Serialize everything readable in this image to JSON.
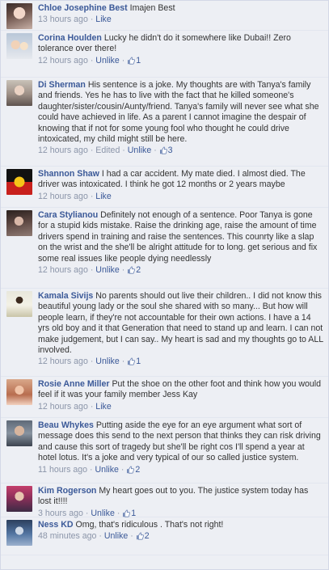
{
  "colors": {
    "link": "#3b5998",
    "meta": "#8b95a9",
    "background": "#edeff4"
  },
  "labels": {
    "like": "Like",
    "unlike": "Unlike",
    "edited": "Edited",
    "sep": "·"
  },
  "icons": {
    "like": "thumbs-up-icon"
  },
  "comments": [
    {
      "id": "c0",
      "name": "Chloe Josephine Best",
      "text": "Imajen Best",
      "time": "13 hours ago",
      "action": "Like",
      "edited": false,
      "likes": null,
      "avatar": "profile-photo"
    },
    {
      "id": "c1",
      "name": "Corina Houlden",
      "text": "Lucky he didn't do it somewhere like Dubai!! Zero tolerance over there!",
      "time": "12 hours ago",
      "action": "Unlike",
      "edited": false,
      "likes": "1",
      "avatar": "profile-photo"
    },
    {
      "id": "c2",
      "name": "Di Sherman",
      "text": "His sentence is a joke. My thoughts are with Tanya's family and friends. Yes he has to live with the fact that he killed someone's daughter/sister/cousin/Aunty/friend. Tanya's family will never see what she could have achieved in life. As a parent I cannot imagine the despair of knowing that if not for some young fool who thought he could drive intoxicated, my child might still be here.",
      "time": "12 hours ago",
      "action": "Unlike",
      "edited": true,
      "likes": "3",
      "avatar": "profile-photo"
    },
    {
      "id": "c3",
      "name": "Shannon Shaw",
      "text": "I had a car accident. My mate died. I almost died. The driver was intoxicated. I think he got 12 months or 2 years maybe",
      "time": "12 hours ago",
      "action": "Like",
      "edited": false,
      "likes": null,
      "avatar": "aboriginal-flag"
    },
    {
      "id": "c4",
      "name": "Cara Stylianou",
      "text": "Definitely not enough of a sentence. Poor Tanya is gone for a stupid kids mistake. Raise the drinking age, raise the amount of time drivers spend in training and raise the sentences. This counrty like a slap on the wrist and the she'll be alright attitude for to long. get serious and fix some real issues like people dying needlessly",
      "time": "12 hours ago",
      "action": "Unlike",
      "edited": false,
      "likes": "2",
      "avatar": "profile-photo"
    },
    {
      "id": "c5",
      "name": "Kamala Sivijs",
      "text": "No parents should out live their children.. I did not know this beautiful young lady or the soul she shared with so many... But how will people learn, if they're not accountable for their own actions. I have a 14 yrs old boy and it that Generation that need to stand up and learn. I can not make judgement, but I can say.. My heart is sad and my thoughts go to ALL involved.",
      "time": "12 hours ago",
      "action": "Unlike",
      "edited": false,
      "likes": "1",
      "avatar": "profile-photo"
    },
    {
      "id": "c6",
      "name": "Rosie Anne Miller",
      "text": "Put the shoe on the other foot and think how you would feel if it was your family member Jess Kay",
      "time": "12 hours ago",
      "action": "Like",
      "edited": false,
      "likes": null,
      "avatar": "profile-photo"
    },
    {
      "id": "c7",
      "name": "Beau Whykes",
      "text": "Putting aside the eye for an eye argument what sort of message does this send to the next person that thinks they can risk driving and cause this sort of tragedy but she'll be right cos I'll spend a year at hotel lotus. It's a joke and very typical of our so called justice system.",
      "time": "11 hours ago",
      "action": "Unlike",
      "edited": false,
      "likes": "2",
      "avatar": "profile-photo"
    },
    {
      "id": "c8",
      "name": "Kim Rogerson",
      "text": "My heart goes out to you. The justice system today has lost it!!!!",
      "time": "3 hours ago",
      "action": "Unlike",
      "edited": false,
      "likes": "1",
      "avatar": "profile-photo"
    },
    {
      "id": "c9",
      "name": "Ness KD",
      "text": "Omg, that's ridiculous . That's not right!",
      "time": "48 minutes ago",
      "action": "Unlike",
      "edited": false,
      "likes": "2",
      "avatar": "profile-photo"
    }
  ]
}
